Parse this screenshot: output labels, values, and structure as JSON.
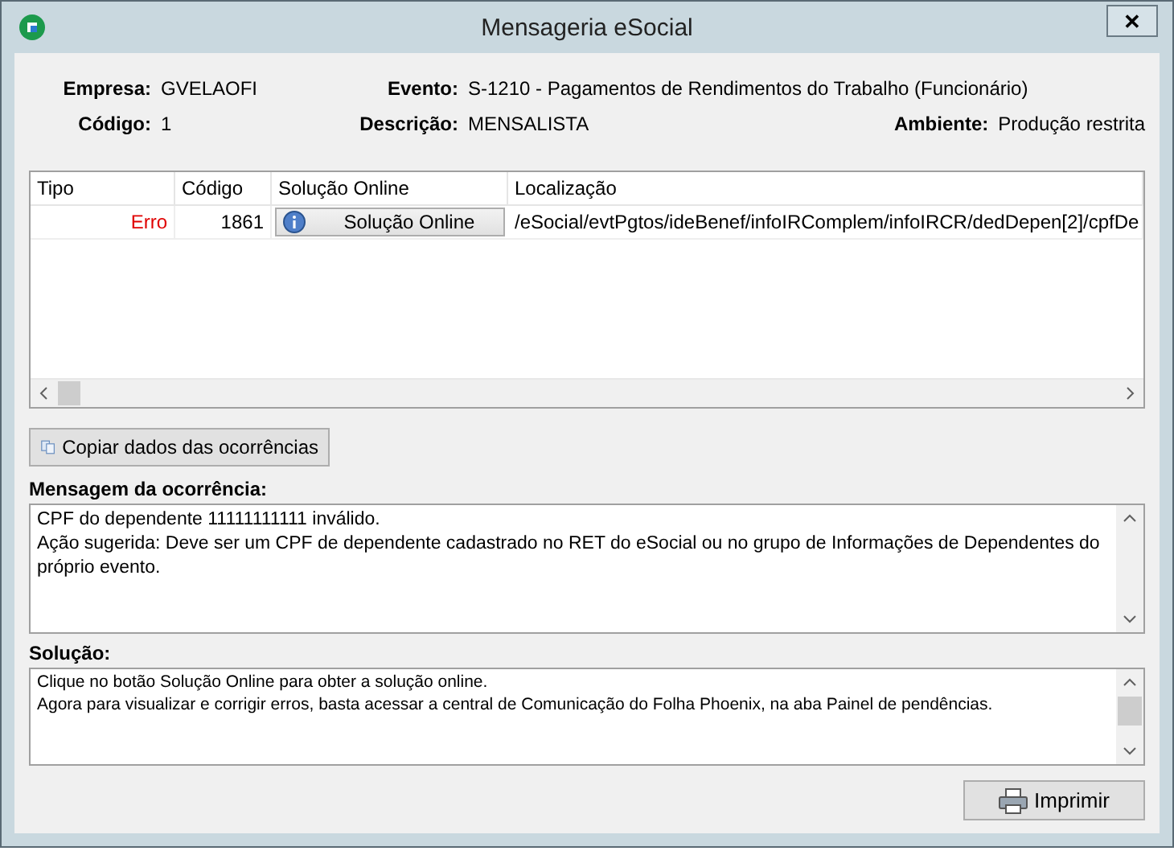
{
  "window": {
    "title": "Mensageria eSocial",
    "close": "✕"
  },
  "info": [
    {
      "label": "Empresa:",
      "value": "GVELAOFI"
    },
    {
      "label": "Evento:",
      "value": "S-1210 - Pagamentos de Rendimentos do Trabalho (Funcionário)"
    },
    {
      "label": "Código:",
      "value": "1"
    },
    {
      "label": "Descrição:",
      "value": "MENSALISTA"
    },
    {
      "label": "Ambiente:",
      "value": "Produção restrita"
    }
  ],
  "table": {
    "columns": [
      "Tipo",
      "Código",
      "Solução Online",
      "Localização"
    ],
    "rows": [
      {
        "kind": "error",
        "tipo": "Erro",
        "codigo": "1861",
        "solucao": "Solução Online",
        "localizacao": "/eSocial/evtPgtos/ideBenef/infoIRComplem/infoIRCR/dedDepen[2]/cpfDe"
      }
    ]
  },
  "copy_button": "Copiar dados das ocorrências",
  "message": {
    "label": "Mensagem da ocorrência:",
    "lines": [
      "CPF do dependente 11111111111 inválido.",
      "Ação sugerida: Deve ser um CPF de dependente cadastrado no RET do eSocial ou no grupo de Informações de Dependentes do próprio evento."
    ]
  },
  "solution": {
    "label": "Solução:",
    "lines": [
      "Clique no botão Solução Online para obter a solução online.",
      "Agora para visualizar e corrigir erros, basta acessar a central de Comunicação do Folha Phoenix, na aba Painel de pendências."
    ]
  },
  "print_button": "Imprimir"
}
